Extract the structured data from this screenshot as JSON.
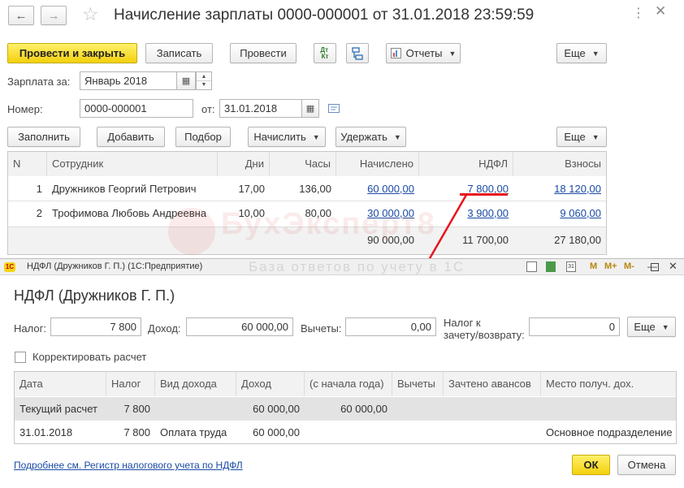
{
  "main": {
    "title": "Начисление зарплаты 0000-000001 от 31.01.2018 23:59:59",
    "toolbar": {
      "post_close": "Провести и закрыть",
      "save": "Записать",
      "post": "Провести",
      "dtkt": "Дт Кт",
      "reports": "Отчеты",
      "more": "Еще"
    },
    "salary_label": "Зарплата за:",
    "salary_value": "Январь 2018",
    "number_label": "Номер:",
    "number_value": "0000-000001",
    "date_label": "от:",
    "date_value": "31.01.2018",
    "table_toolbar": {
      "fill": "Заполнить",
      "add": "Добавить",
      "pick": "Подбор",
      "accrue": "Начислить",
      "withhold": "Удержать",
      "more": "Еще"
    },
    "columns": [
      "N",
      "Сотрудник",
      "Дни",
      "Часы",
      "Начислено",
      "НДФЛ",
      "Взносы"
    ],
    "rows": [
      {
        "n": "1",
        "employee": "Дружников Георгий Петрович",
        "days": "17,00",
        "hours": "136,00",
        "accrued": "60 000,00",
        "ndfl": "7 800,00",
        "contrib": "18 120,00"
      },
      {
        "n": "2",
        "employee": "Трофимова Любовь Андреевна",
        "days": "10,00",
        "hours": "80,00",
        "accrued": "30 000,00",
        "ndfl": "3 900,00",
        "contrib": "9 060,00"
      }
    ],
    "totals": {
      "accrued": "90 000,00",
      "ndfl": "11 700,00",
      "contrib": "27 180,00"
    }
  },
  "watermark": {
    "brand": "БухЭксперт8",
    "tagline": "База ответов по учету в 1С"
  },
  "dialog": {
    "window_title": "НДФЛ (Дружников Г. П.) (1С:Предприятие)",
    "heading": "НДФЛ (Дружников Г. П.)",
    "tax_label": "Налог:",
    "tax_value": "7 800",
    "income_label": "Доход:",
    "income_value": "60 000,00",
    "deductions_label": "Вычеты:",
    "deductions_value": "0,00",
    "offset_label_1": "Налог к",
    "offset_label_2": "зачету/возврату:",
    "offset_value": "0",
    "more": "Еще",
    "correct_label": "Корректировать расчет",
    "columns": [
      "Дата",
      "Налог",
      "Вид дохода",
      "Доход",
      "(с начала года)",
      "Вычеты",
      "Зачтено авансов",
      "Место получ. дох."
    ],
    "rows": [
      {
        "date": "Текущий расчет",
        "tax": "7 800",
        "type": "",
        "income": "60 000,00",
        "ytd": "60 000,00",
        "deductions": "",
        "advances": "",
        "place": ""
      },
      {
        "date": "31.01.2018",
        "tax": "7 800",
        "type": "Оплата труда",
        "income": "60 000,00",
        "ytd": "",
        "deductions": "",
        "advances": "",
        "place": "Основное подразделение"
      }
    ],
    "link": "Подробнее см. Регистр налогового учета по НДФЛ",
    "ok": "ОК",
    "cancel": "Отмена",
    "title_icons": {
      "m": "M",
      "mplus": "M+",
      "mminus": "M-",
      "cal": "31"
    }
  },
  "colors": {
    "accent_yellow": "#f5d516",
    "link_blue": "#1a4aa5",
    "annotation_red": "#e8141b",
    "selected_row": "#e3e3e3"
  }
}
